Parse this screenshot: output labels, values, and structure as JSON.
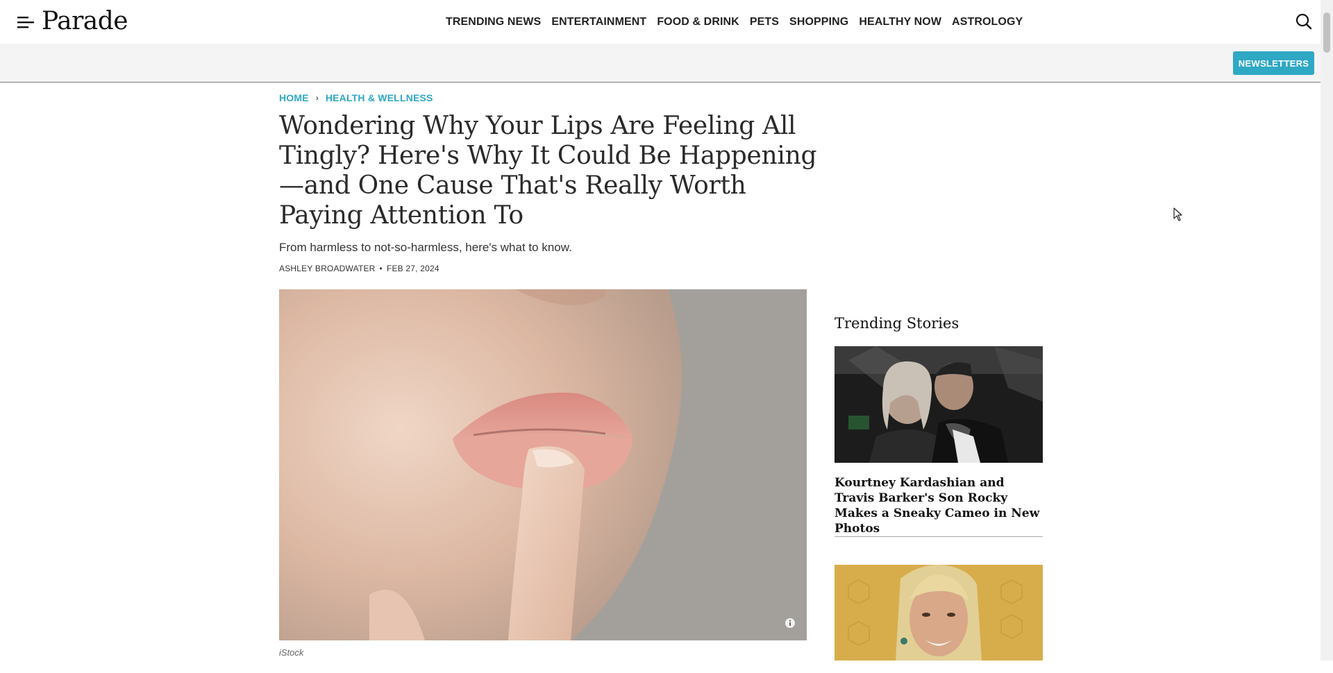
{
  "header": {
    "logo": "Parade",
    "nav": [
      {
        "label": "TRENDING NEWS"
      },
      {
        "label": "ENTERTAINMENT"
      },
      {
        "label": "FOOD & DRINK"
      },
      {
        "label": "PETS"
      },
      {
        "label": "SHOPPING"
      },
      {
        "label": "HEALTHY NOW"
      },
      {
        "label": "ASTROLOGY"
      }
    ]
  },
  "subbar": {
    "newsletters_label": "NEWSLETTERS"
  },
  "breadcrumb": {
    "home": "HOME",
    "section": "HEALTH & WELLNESS",
    "separator": "›"
  },
  "article": {
    "headline": "Wondering Why Your Lips Are Feeling All Tingly? Here's Why It Could Be Happening—and One Cause That's Really Worth Paying Attention To",
    "dek": "From harmless to not-so-harmless, here's what to know.",
    "author": "ASHLEY BROADWATER",
    "byline_separator": "•",
    "date": "FEB 27, 2024",
    "image_credit": "iStock"
  },
  "sidebar": {
    "title": "Trending Stories",
    "stories": [
      {
        "title": "Kourtney Kardashian and Travis Barker's Son Rocky Makes a Sneaky Cameo in New Photos"
      },
      {
        "title": ""
      }
    ]
  },
  "colors": {
    "accent": "#2fa8c4",
    "subbar_bg": "#f4f4f4",
    "text": "#2a2a2a"
  },
  "icons": {
    "menu": "menu-icon",
    "search": "search-icon",
    "info": "info-icon",
    "breadcrumb_sep": "chevron-right-icon"
  }
}
